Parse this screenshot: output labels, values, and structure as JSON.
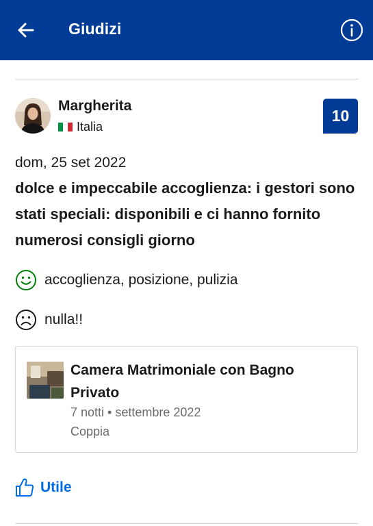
{
  "header": {
    "title": "Giudizi",
    "background_color": "#003b95",
    "back_icon": "arrow-left-icon",
    "info_icon": "info-circle-icon"
  },
  "review": {
    "reviewer_name": "Margherita",
    "country": "Italia",
    "country_flag_icon": "italy-flag-icon",
    "score": "10",
    "date": "dom, 25 set 2022",
    "title": "dolce e impeccabile accoglienza: i gestori sono stati speciali: disponibili e ci hanno fornito numerosi consigli giorno",
    "positive": {
      "icon": "smiley-happy-icon",
      "text": "accoglienza, posizione, pulizia",
      "color": "#008009"
    },
    "negative": {
      "icon": "smiley-sad-icon",
      "text": "nulla!!",
      "color": "#1a1a1a"
    }
  },
  "room": {
    "name": "Camera Matrimoniale con Bagno Privato",
    "stay": "7 notti • settembre 2022",
    "traveler_type": "Coppia"
  },
  "actions": {
    "helpful_label": "Utile",
    "helpful_icon": "thumbs-up-icon",
    "accent_color": "#006ce4"
  }
}
